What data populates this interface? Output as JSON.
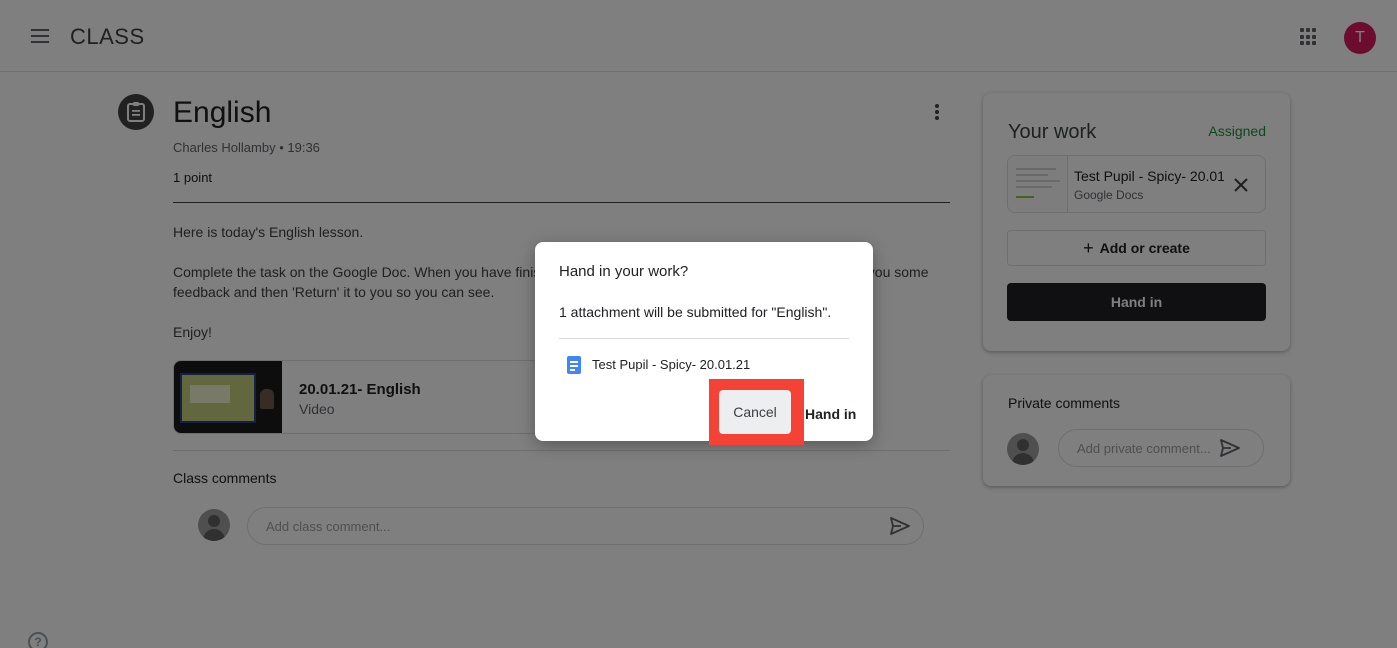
{
  "app": {
    "brand": "CLASS",
    "user_initial": "T"
  },
  "assignment": {
    "title": "English",
    "meta": "Charles Hollamby • 19:36",
    "points": "1 point",
    "body": [
      "Here is today's English lesson.",
      "Complete the task on the Google Doc. When you have finished, click 'Hand in'. Your teacher will mark this, write you some feedback and then 'Return' it to you so you can see.",
      "Enjoy!"
    ],
    "attachment": {
      "title": "20.01.21- English",
      "type": "Video"
    }
  },
  "class_comments": {
    "label": "Class comments",
    "placeholder": "Add class comment..."
  },
  "your_work": {
    "title": "Your work",
    "status": "Assigned",
    "status_color": "#1e8e3e",
    "file": {
      "name": "Test Pupil - Spicy- 20.01.21",
      "type": "Google Docs"
    },
    "add_label": "Add or create",
    "hand_in_label": "Hand in"
  },
  "private_comments": {
    "label": "Private comments",
    "placeholder": "Add private comment..."
  },
  "dialog": {
    "title": "Hand in your work?",
    "message": "1 attachment will be submitted for \"English\".",
    "file_name": "Test Pupil - Spicy- 20.01.21",
    "cancel_label": "Cancel",
    "confirm_label": "Hand in",
    "highlight_color": "#f44336"
  },
  "icons": {
    "menu": "menu-icon",
    "apps": "apps-grid-icon",
    "assignment": "assignment-icon",
    "more": "more-vert-icon",
    "close": "close-icon",
    "send": "send-icon",
    "help": "help-icon",
    "doc": "google-doc-icon"
  }
}
